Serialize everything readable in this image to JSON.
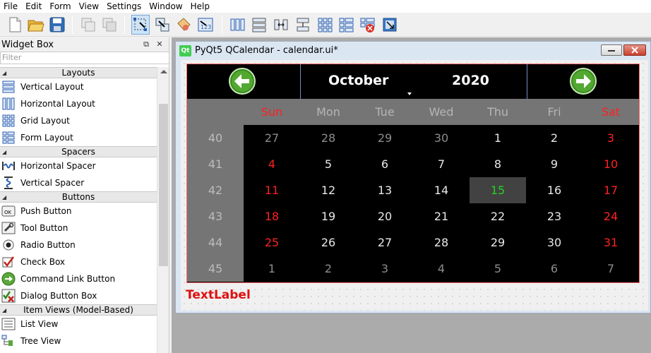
{
  "menubar": [
    "File",
    "Edit",
    "Form",
    "View",
    "Settings",
    "Window",
    "Help"
  ],
  "toolbar": {
    "buttons": [
      "new-form-icon",
      "open-form-icon",
      "save-form-icon",
      "cut-icon",
      "copy-icon",
      "edit-widgets-icon",
      "edit-signals-slots-icon",
      "edit-buddies-icon",
      "edit-tab-order-icon",
      "layout-horizontal-icon",
      "layout-vertical-icon",
      "layout-horizontal-splitter-icon",
      "layout-vertical-splitter-icon",
      "layout-grid-icon",
      "layout-form-icon",
      "break-layout-icon",
      "adjust-size-icon"
    ]
  },
  "widget_box": {
    "title": "Widget Box",
    "filter_placeholder": "Filter",
    "categories": [
      {
        "label": "Layouts",
        "items": [
          "Vertical Layout",
          "Horizontal Layout",
          "Grid Layout",
          "Form Layout"
        ]
      },
      {
        "label": "Spacers",
        "items": [
          "Horizontal Spacer",
          "Vertical Spacer"
        ]
      },
      {
        "label": "Buttons",
        "items": [
          "Push Button",
          "Tool Button",
          "Radio Button",
          "Check Box",
          "Command Link Button",
          "Dialog Button Box"
        ]
      },
      {
        "label": "Item Views (Model-Based)",
        "items": [
          "List View",
          "Tree View"
        ]
      }
    ]
  },
  "form_window": {
    "title": "PyQt5 QCalendar - calendar.ui*",
    "logo_text": "Qt"
  },
  "calendar": {
    "month": "October",
    "year": "2020",
    "day_headers": [
      "Sun",
      "Mon",
      "Tue",
      "Wed",
      "Thu",
      "Fri",
      "Sat"
    ],
    "week_numbers": [
      "40",
      "41",
      "42",
      "43",
      "44",
      "45"
    ],
    "weeks": [
      [
        "27",
        "28",
        "29",
        "30",
        "1",
        "2",
        "3"
      ],
      [
        "4",
        "5",
        "6",
        "7",
        "8",
        "9",
        "10"
      ],
      [
        "11",
        "12",
        "13",
        "14",
        "15",
        "16",
        "17"
      ],
      [
        "18",
        "19",
        "20",
        "21",
        "22",
        "23",
        "24"
      ],
      [
        "25",
        "26",
        "27",
        "28",
        "29",
        "30",
        "31"
      ],
      [
        "1",
        "2",
        "3",
        "4",
        "5",
        "6",
        "7"
      ]
    ],
    "selected_day": "15",
    "colors": {
      "weekend": "#ff2020",
      "selected": "#23d223",
      "header_bg": "#757575"
    }
  },
  "text_label": "TextLabel"
}
